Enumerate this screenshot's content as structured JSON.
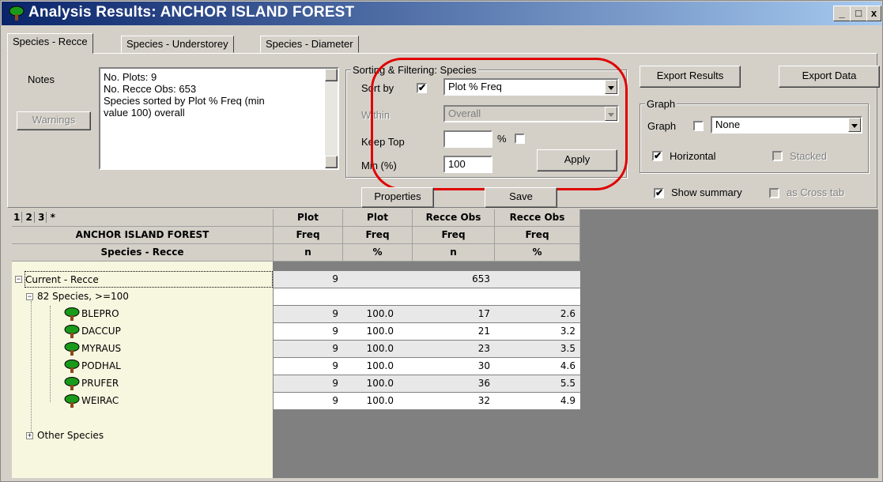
{
  "window": {
    "title": "Analysis Results: ANCHOR ISLAND FOREST",
    "minimize": "_",
    "maximize": "□",
    "close": "x"
  },
  "tabs": [
    {
      "label": "Species - Recce",
      "active": true
    },
    {
      "label": "Species - Understorey",
      "active": false
    },
    {
      "label": "Species - Diameter",
      "active": false
    }
  ],
  "notes": {
    "label": "Notes",
    "warnings_button": "Warnings",
    "lines": [
      "No. Plots: 9",
      "No. Recce Obs: 653",
      "Species sorted by Plot % Freq (min",
      "value 100) overall"
    ]
  },
  "sorting": {
    "group_title": "Sorting & Filtering: Species",
    "sort_by_label": "Sort by",
    "sort_by_checked": true,
    "sort_by_value": "Plot % Freq",
    "within_label": "Within",
    "within_value": "Overall",
    "keep_top_label": "Keep Top",
    "keep_top_value": "",
    "percent_label": "%",
    "min_label": "Min (%)",
    "min_value": "100",
    "apply_button": "Apply"
  },
  "export": {
    "results_button": "Export Results",
    "data_button": "Export Data"
  },
  "graph": {
    "group_title": "Graph",
    "graph_label": "Graph",
    "graph_value": "None",
    "horizontal_label": "Horizontal",
    "horizontal_checked": true,
    "stacked_label": "Stacked",
    "show_summary_label": "Show summary",
    "show_summary_checked": true,
    "cross_tab_label": "as Cross tab"
  },
  "buttons": {
    "properties": "Properties",
    "save": "Save"
  },
  "grid": {
    "level_buttons": [
      "1",
      "2",
      "3",
      "*"
    ],
    "header_row1": [
      "Plot",
      "Plot",
      "Recce Obs",
      "Recce Obs"
    ],
    "header_row2_title": "ANCHOR ISLAND FOREST",
    "header_row2": [
      "Freq",
      "Freq",
      "Freq",
      "Freq"
    ],
    "header_row3_title": "Species - Recce",
    "header_row3": [
      "n",
      "%",
      "n",
      "%"
    ],
    "group_row": {
      "label": "Current - Recce",
      "values": [
        "9",
        "",
        "653",
        ""
      ]
    },
    "subgroup_row": {
      "label": "82 Species, >=100"
    },
    "species": [
      {
        "name": "BLEPRO",
        "values": [
          "9",
          "100.0",
          "17",
          "2.6"
        ]
      },
      {
        "name": "DACCUP",
        "values": [
          "9",
          "100.0",
          "21",
          "3.2"
        ]
      },
      {
        "name": "MYRAUS",
        "values": [
          "9",
          "100.0",
          "23",
          "3.5"
        ]
      },
      {
        "name": "PODHAL",
        "values": [
          "9",
          "100.0",
          "30",
          "4.6"
        ]
      },
      {
        "name": "PRUFER",
        "values": [
          "9",
          "100.0",
          "36",
          "5.5"
        ]
      },
      {
        "name": "WEIRAC",
        "values": [
          "9",
          "100.0",
          "32",
          "4.9"
        ]
      }
    ],
    "other_row": {
      "label": "Other Species"
    }
  },
  "colors": {
    "highlight": "#e00000",
    "row_alt": "#e8e8e8",
    "tree_bg": "#f7f7e0"
  }
}
